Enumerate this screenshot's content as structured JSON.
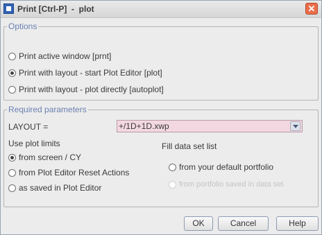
{
  "window": {
    "title": "Print [Ctrl-P]  -  plot",
    "close_glyph": "✕"
  },
  "options": {
    "legend": "Options",
    "items": [
      {
        "label": "Print active window [prnt]",
        "checked": false
      },
      {
        "label": "Print with layout - start Plot Editor [plot]",
        "checked": true
      },
      {
        "label": "Print with layout - plot directly [autoplot]",
        "checked": false
      }
    ]
  },
  "params": {
    "legend": "Required parameters",
    "layout_label": "LAYOUT =",
    "layout_value": "+/1D+1D.xwp",
    "layout_field_color": "#f3d8e2",
    "plot_limits_label": "Use plot limits",
    "plot_limits": [
      {
        "label": "from screen / CY",
        "checked": true
      },
      {
        "label": "from Plot Editor Reset Actions",
        "checked": false
      },
      {
        "label": "as saved in Plot Editor",
        "checked": false
      }
    ],
    "fill_label": "Fill data set list",
    "fill_options": [
      {
        "label": "from your default portfolio",
        "checked": false,
        "disabled": false
      },
      {
        "label": "from portfolio saved in data set",
        "checked": false,
        "disabled": true
      }
    ]
  },
  "buttons": {
    "ok": "OK",
    "cancel": "Cancel",
    "help": "Help"
  },
  "colors": {
    "legend": "#6a7fb0",
    "close": "#ea6e4b",
    "app_icon": "#2f63b8"
  }
}
